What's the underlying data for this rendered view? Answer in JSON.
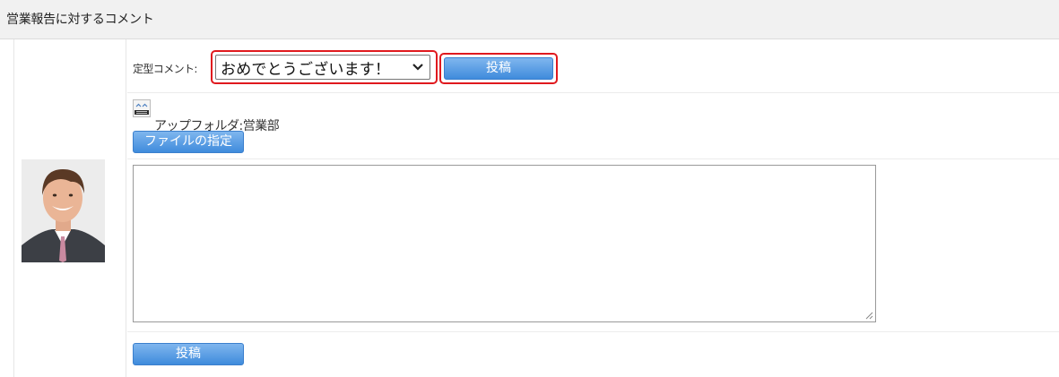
{
  "section": {
    "title": "営業報告に対するコメント"
  },
  "template": {
    "label": "定型コメント:",
    "selected": "おめでとうございます！"
  },
  "buttons": {
    "post_top": "投稿",
    "file_select": "ファイルの指定",
    "post_bottom": "投稿"
  },
  "upload": {
    "folder_text": "アップフォルダ:営業部",
    "emoji_icon": "emoji-icon"
  },
  "comment": {
    "value": "",
    "placeholder": ""
  },
  "colors": {
    "highlight": "#e0191e",
    "button": "#4a90e2",
    "header_bg": "#f1f1f1"
  }
}
